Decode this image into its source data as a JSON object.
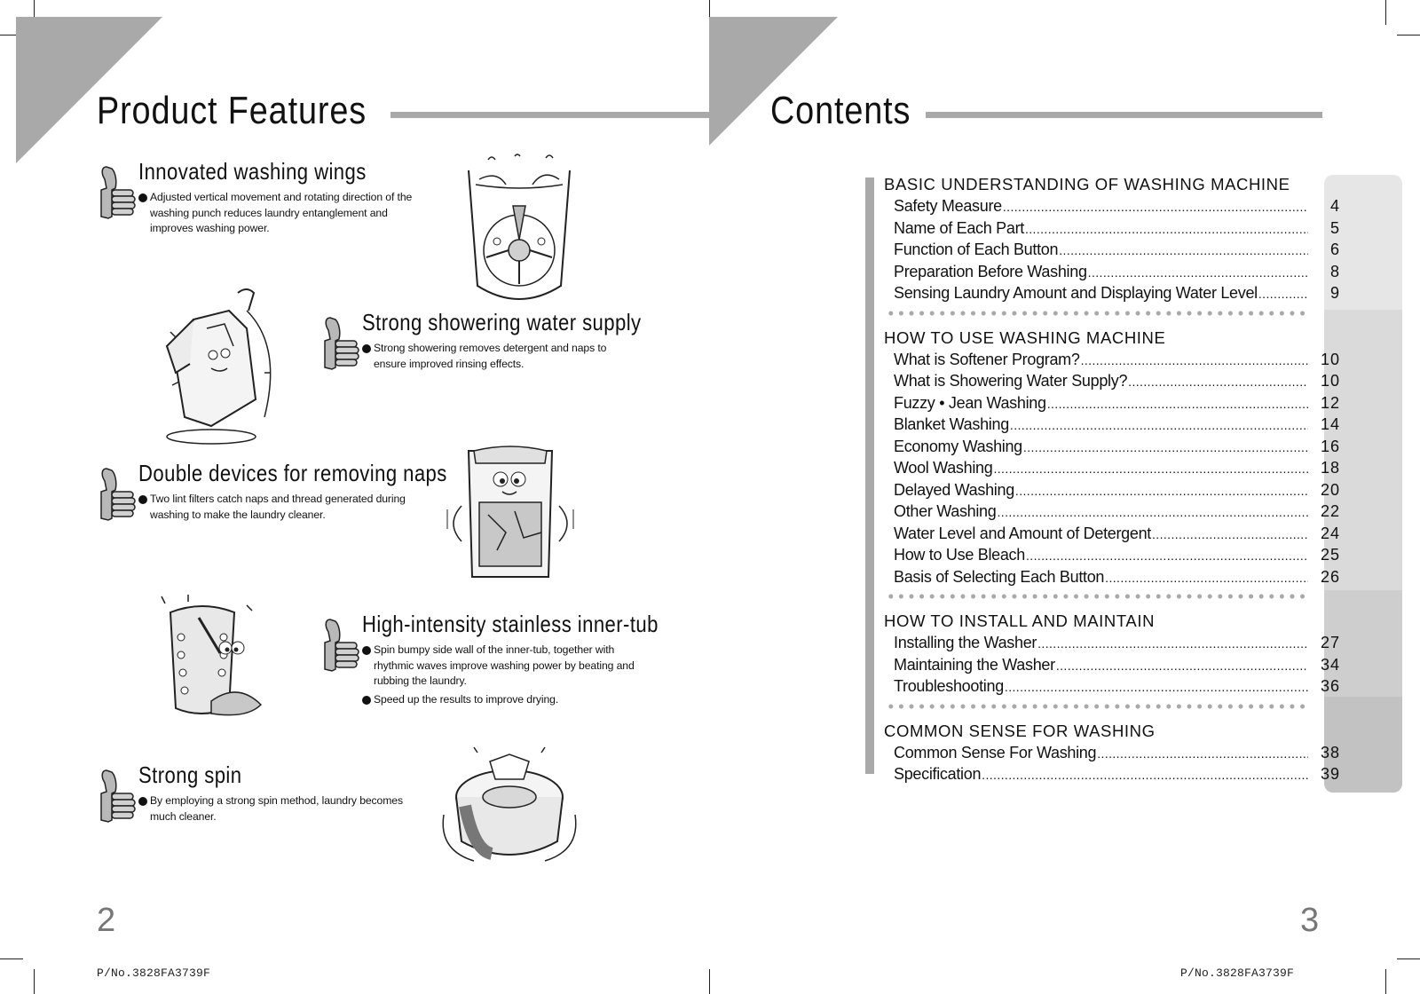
{
  "left_page": {
    "title": "Product Features",
    "page_number": "2",
    "part_number": "P/No.3828FA3739F",
    "features": [
      {
        "title": "Innovated washing wings",
        "bullets": [
          "Adjusted vertical movement and rotating direction of the washing punch reduces laundry entanglement and improves washing power."
        ]
      },
      {
        "title": "Strong showering water supply",
        "bullets": [
          "Strong showering removes detergent and naps to ensure improved rinsing effects."
        ]
      },
      {
        "title": "Double devices for removing naps",
        "bullets": [
          "Two lint filters catch naps and thread generated during washing to make the laundry cleaner."
        ]
      },
      {
        "title": "High-intensity stainless inner-tub",
        "bullets": [
          "Spin bumpy side wall of the inner-tub, together with rhythmic waves improve washing power by beating and rubbing the laundry.",
          "Speed up the results to improve drying."
        ]
      },
      {
        "title": "Strong spin",
        "bullets": [
          "By employing a strong spin method, laundry becomes much cleaner."
        ]
      }
    ],
    "illustrations": [
      "washing-wings-tub-illustration",
      "shirt-under-shower-illustration",
      "washer-with-lint-filters-illustration",
      "stainless-tub-character-illustration",
      "spinning-laundry-illustration"
    ]
  },
  "right_page": {
    "title": "Contents",
    "page_number": "3",
    "part_number": "P/No.3828FA3739F",
    "sections": [
      {
        "heading": "BASIC UNDERSTANDING OF WASHING MACHINE",
        "items": [
          {
            "label": "Safety Measure",
            "page": "4"
          },
          {
            "label": "Name of Each Part",
            "page": "5"
          },
          {
            "label": "Function of Each Button",
            "page": "6"
          },
          {
            "label": "Preparation Before Washing",
            "page": "8"
          },
          {
            "label": "Sensing Laundry Amount and Displaying Water Level",
            "page": "9"
          }
        ]
      },
      {
        "heading": "HOW TO USE WASHING MACHINE",
        "items": [
          {
            "label": "What is Softener Program?",
            "page": "10"
          },
          {
            "label": "What is Showering Water Supply?",
            "page": "10"
          },
          {
            "label": "Fuzzy • Jean Washing",
            "page": "12"
          },
          {
            "label": "Blanket Washing",
            "page": "14"
          },
          {
            "label": "Economy Washing",
            "page": "16"
          },
          {
            "label": "Wool Washing",
            "page": "18"
          },
          {
            "label": "Delayed Washing",
            "page": "20"
          },
          {
            "label": "Other Washing",
            "page": "22"
          },
          {
            "label": "Water Level and Amount of Detergent",
            "page": "24"
          },
          {
            "label": "How to Use Bleach",
            "page": "25"
          },
          {
            "label": "Basis of Selecting Each Button",
            "page": "26"
          }
        ]
      },
      {
        "heading": "HOW TO INSTALL AND MAINTAIN",
        "items": [
          {
            "label": "Installing the Washer",
            "page": "27"
          },
          {
            "label": "Maintaining the Washer",
            "page": "34"
          },
          {
            "label": "Troubleshooting",
            "page": "36"
          }
        ]
      },
      {
        "heading": "COMMON SENSE FOR WASHING",
        "items": [
          {
            "label": "Common Sense For Washing",
            "page": "38"
          },
          {
            "label": "Specification",
            "page": "39"
          }
        ]
      }
    ],
    "page_column_colors": [
      "#e6e6e6",
      "#dadada",
      "#cecece",
      "#c2c2c2"
    ]
  },
  "colors": {
    "accent_gray": "#a9a9a9",
    "text": "#111111",
    "page_number": "#777777"
  }
}
